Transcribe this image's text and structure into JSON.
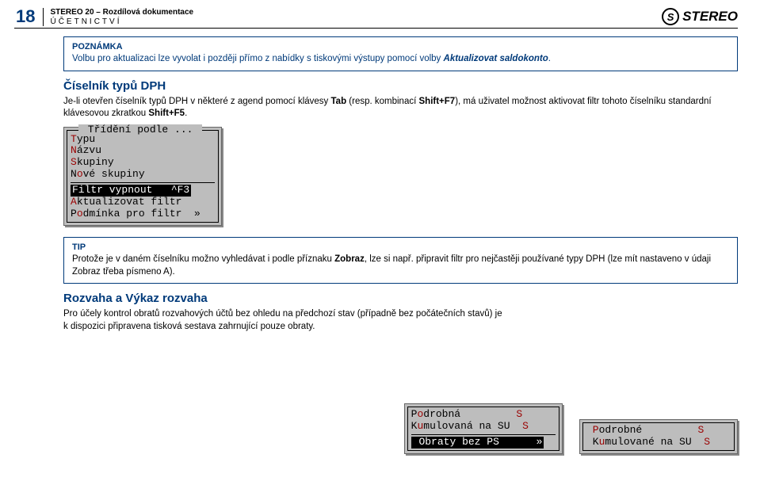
{
  "header": {
    "page_number": "18",
    "title": "STEREO 20 – Rozdílová dokumentace",
    "subtitle": "ÚČETNICTVÍ",
    "logo_letter": "S",
    "logo_text": "STEREO"
  },
  "note_box": {
    "title": "POZNÁMKA",
    "text_pre": "Volbu pro aktualizaci lze vyvolat i později přímo z nabídky s tiskovými výstupy pomocí volby ",
    "text_em": "Aktualizovat saldokonto",
    "text_post": "."
  },
  "section1": {
    "heading": "Číselník typů DPH",
    "p_pre": "Je-li otevřen číselník typů DPH v některé z agend pomocí klávesy ",
    "p_key1": "Tab",
    "p_mid1": " (resp. kombinací ",
    "p_key2": "Shift+F7",
    "p_mid2": "), má uživatel možnost aktivovat filtr tohoto číselníku standardní klávesovou zkratkou ",
    "p_key3": "Shift+F5",
    "p_post": "."
  },
  "dos1": {
    "legend": " Třídění podle ... ",
    "r1a": "T",
    "r1b": "ypu",
    "r2a": "N",
    "r2b": "ázvu",
    "r3a": "S",
    "r3b": "kupiny",
    "r4a": "N",
    "r4b": "o",
    "r4c": "vé skupiny",
    "r5": "Filtr vypnout   ^F3",
    "r6a": "A",
    "r6b": "ktualizovat filtr",
    "r7a": "P",
    "r7b": "o",
    "r7c": "dmínka pro filtr  »"
  },
  "tip_box": {
    "title": "TIP",
    "text_pre": "Protože je v daném číselníku možno vyhledávat i podle příznaku ",
    "text_b": "Zobraz",
    "text_post": ", lze si např. připravit filtr pro nejčastěji používané typy DPH (lze mít nastaveno v údaji Zobraz třeba písmeno A)."
  },
  "section2": {
    "heading": "Rozvaha a Výkaz rozvaha",
    "para": "Pro účely kontrol obratů rozvahových účtů bez ohledu na předchozí stav (případně bez počátečních stavů) je k dispozici připravena tisková sestava zahrnující pouze obraty."
  },
  "dos2": {
    "b1r1a": "P",
    "b1r1b": "o",
    "b1r1c": "drobná         ",
    "b1r1d": "S",
    "b1r2a": "K",
    "b1r2b": "u",
    "b1r2c": "mulovaná na SU  ",
    "b1r2d": "S",
    "b2": " Obraty bez PS      »",
    "b3r1a": " P",
    "b3r1b": "odrobné         ",
    "b3r1c": "S",
    "b3r2a": " K",
    "b3r2b": "u",
    "b3r2c": "mulované na SU  ",
    "b3r2d": "S"
  }
}
